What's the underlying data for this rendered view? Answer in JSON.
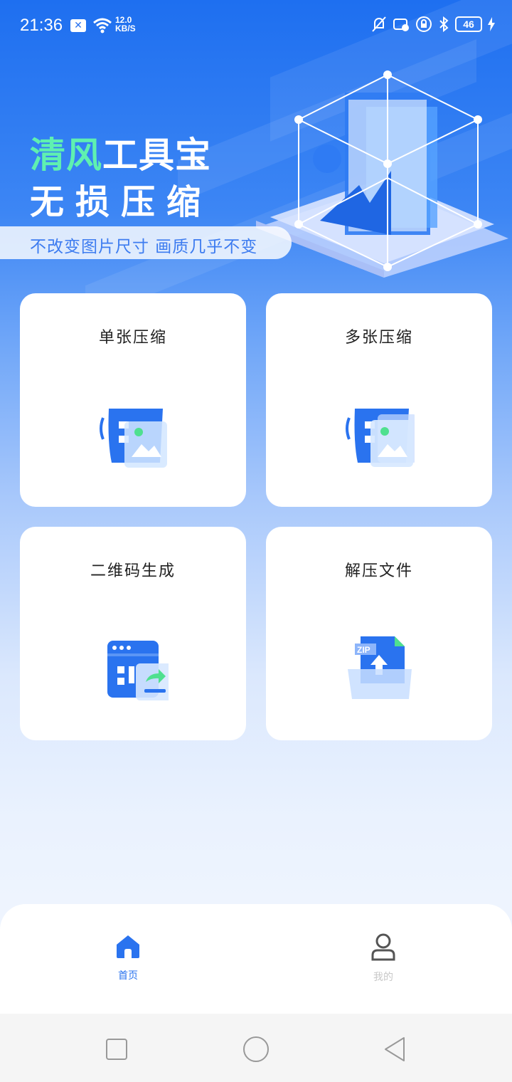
{
  "status_bar": {
    "time": "21:36",
    "net_speed_value": "12.0",
    "net_speed_unit": "KB/S",
    "battery": "46",
    "icons": [
      "close-notification-icon",
      "wifi-icon",
      "mute-icon",
      "sync-icon",
      "lock-icon",
      "bluetooth-icon",
      "battery-icon",
      "charging-icon"
    ]
  },
  "hero": {
    "title_accent": "清风",
    "title_rest": "工具宝",
    "subtitle": "无损压缩",
    "tagline": "不改变图片尺寸 画质几乎不变"
  },
  "cards": [
    {
      "label": "单张压缩",
      "icon": "single-image-compress-icon"
    },
    {
      "label": "多张压缩",
      "icon": "multi-image-compress-icon"
    },
    {
      "label": "二维码生成",
      "icon": "qr-code-generate-icon"
    },
    {
      "label": "解压文件",
      "icon": "zip-extract-icon"
    }
  ],
  "bottom_nav": {
    "items": [
      {
        "label": "首页",
        "icon": "home-icon",
        "active": true
      },
      {
        "label": "我的",
        "icon": "user-icon",
        "active": false
      }
    ]
  },
  "colors": {
    "primary": "#2a73ef",
    "accent_green": "#5ff0b0",
    "nav_inactive": "#c8c8c8"
  },
  "system_nav": [
    "recent-apps-icon",
    "home-circle-icon",
    "back-icon"
  ]
}
